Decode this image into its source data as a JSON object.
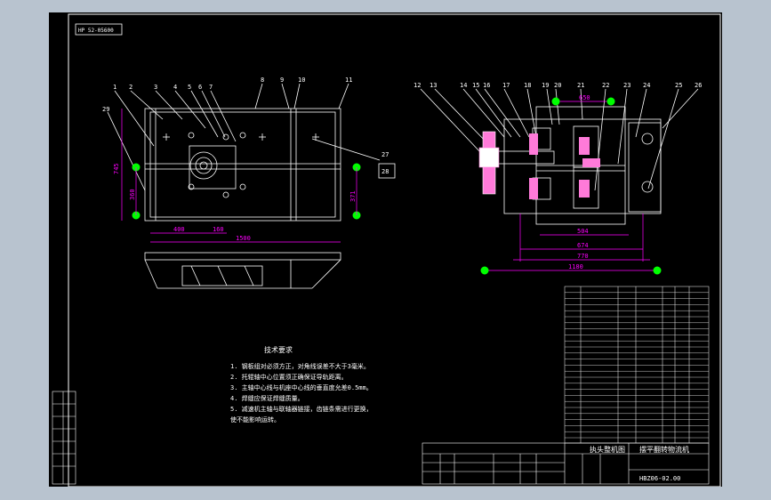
{
  "drawing": {
    "code_box": "HP 52-05600",
    "title_block": {
      "drawing_name": "执头整机图",
      "machine_name": "摆平翻转物流机",
      "drawing_number": "HBZ06-02.00"
    },
    "tech_requirements": {
      "title": "技术要求",
      "lines": [
        "1. 钢板组对必须方正，对角线误差不大于3毫米。",
        "2. 托辊轴中心位置须正确保证导轨距离。",
        "3. 主轴中心线与机座中心线的垂直度允差0.5mm。",
        "4. 焊缝应保证焊缝质量。",
        "5. 减速机主轴与联轴器链接，齿链条需进行更换，",
        "   使不能影响运转。"
      ]
    },
    "left_view": {
      "part_labels": [
        "1",
        "2",
        "3",
        "4",
        "5",
        "6",
        "7",
        "8",
        "9",
        "10",
        "11"
      ],
      "side_label_29": "29",
      "dims": {
        "width_total": "1500",
        "d400": "400",
        "d160": "160",
        "height_745": "745",
        "d360": "360",
        "d371": "371",
        "label_27": "27",
        "label_28": "28"
      }
    },
    "right_view": {
      "part_labels": [
        "12",
        "13",
        "14",
        "15",
        "16",
        "17",
        "18",
        "19",
        "20",
        "21",
        "22",
        "23",
        "24",
        "25",
        "26"
      ],
      "dims": {
        "d650": "650",
        "d504": "504",
        "d674": "674",
        "d770": "770",
        "d1180": "1180"
      }
    },
    "colors": {
      "line": "#ffffff",
      "dim": "#ff00ff",
      "accent": "#00ff00",
      "paper": "#000000",
      "frame": "#b8c3cf"
    }
  }
}
